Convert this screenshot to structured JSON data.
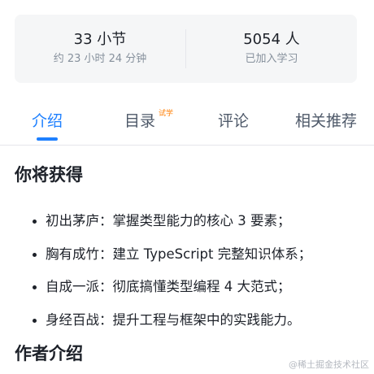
{
  "stats": {
    "sections_value": "33 小节",
    "sections_sub": "约 23 小时 24 分钟",
    "learners_value": "5054 人",
    "learners_sub": "已加入学习"
  },
  "tabs": [
    {
      "label": "介绍",
      "active": true
    },
    {
      "label": "目录",
      "badge": "试学"
    },
    {
      "label": "评论"
    },
    {
      "label": "相关推荐"
    }
  ],
  "gain_section": {
    "title": "你将获得",
    "items": [
      "初出茅庐：掌握类型能力的核心 3 要素；",
      "胸有成竹：建立 TypeScript 完整知识体系；",
      "自成一派：彻底搞懂类型编程 4 大范式；",
      "身经百战：提升工程与框架中的实践能力。"
    ]
  },
  "author_section": {
    "title": "作者介绍"
  },
  "watermark": "@稀土掘金技术社区",
  "colors": {
    "accent": "#1e80ff",
    "badge": "#ff7d00",
    "muted": "#86909c"
  }
}
